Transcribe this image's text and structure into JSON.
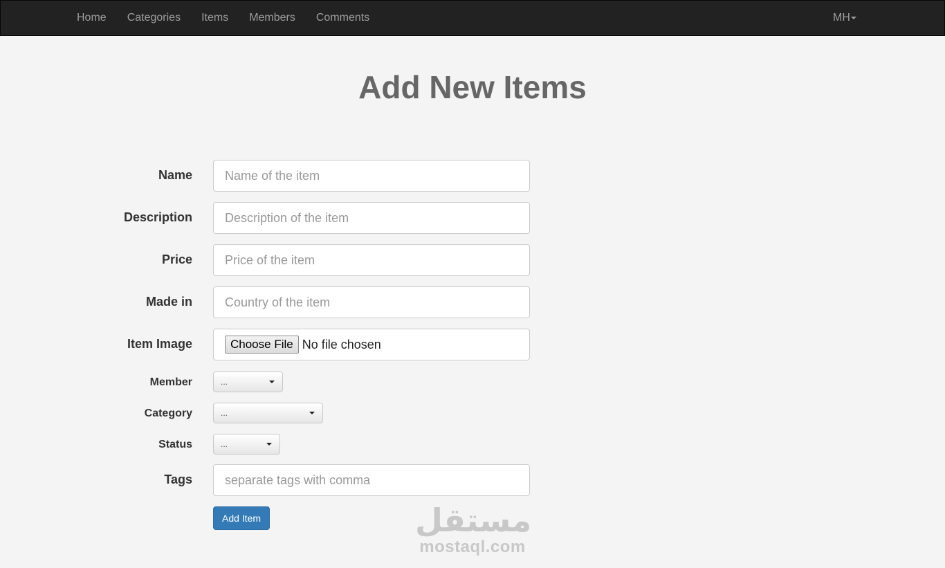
{
  "nav": {
    "links": [
      "Home",
      "Categories",
      "Items",
      "Members",
      "Comments"
    ],
    "user": "MH"
  },
  "page": {
    "title": "Add New Items"
  },
  "form": {
    "name": {
      "label": "Name",
      "placeholder": "Name of the item"
    },
    "description": {
      "label": "Description",
      "placeholder": "Description of the item"
    },
    "price": {
      "label": "Price",
      "placeholder": "Price of the item"
    },
    "made_in": {
      "label": "Made in",
      "placeholder": "Country of the item"
    },
    "image": {
      "label": "Item Image",
      "button": "Choose File",
      "status": "No file chosen"
    },
    "member": {
      "label": "Member",
      "selected": "..."
    },
    "category": {
      "label": "Category",
      "selected": "..."
    },
    "status": {
      "label": "Status",
      "selected": "..."
    },
    "tags": {
      "label": "Tags",
      "placeholder": "separate tags with comma"
    },
    "submit": "Add Item"
  },
  "watermark": {
    "arabic": "مستقل",
    "latin": "mostaql.com"
  },
  "colors": {
    "navbar": "#222222",
    "primary": "#337ab7",
    "background": "#f4f4f4"
  }
}
